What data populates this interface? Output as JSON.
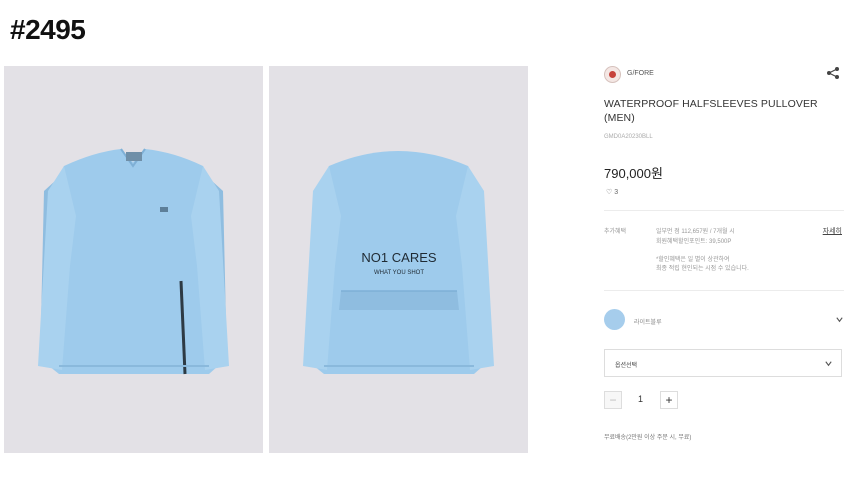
{
  "page_id": "#2495",
  "images": {
    "front_alt": "front view of light blue pullover",
    "back_alt": "back view of light blue pullover",
    "back_print_line1": "NO1 CARES",
    "back_print_line2": "WHAT YOU SHOT"
  },
  "brand": {
    "name": "G/FORE",
    "logo_icon": "brand-logo-icon",
    "share_icon": "share-icon"
  },
  "product": {
    "title": "WATERPROOF HALFSLEEVES PULLOVER (MEN)",
    "code": "GMD0A20230BLL",
    "price": "790,000원",
    "likes": "♡ 3"
  },
  "benefits": {
    "label": "추가혜택",
    "line1": "일부먼 점 112,657원 / 7개월 시",
    "line2": "회원혜택할인포인트: 39,500P",
    "line3": "*할인혜택은 일 별이 상관하여",
    "line4": "최종 적립 현인되는 시점 수 있습니다.",
    "more_label": "자세히"
  },
  "colors": {
    "primary": "#a6cdec",
    "garment": "#9ecbec",
    "photo_bg": "#e3e1e6"
  },
  "color_option": {
    "name": "라이트블루",
    "swatch_color": "#a6cdec"
  },
  "option_select": {
    "label": "옵션선택"
  },
  "quantity": {
    "value": "1",
    "minus": "−",
    "plus": "+"
  },
  "shipping": {
    "text": "무료배송(2만원 이상 주문 시, 무료)"
  }
}
